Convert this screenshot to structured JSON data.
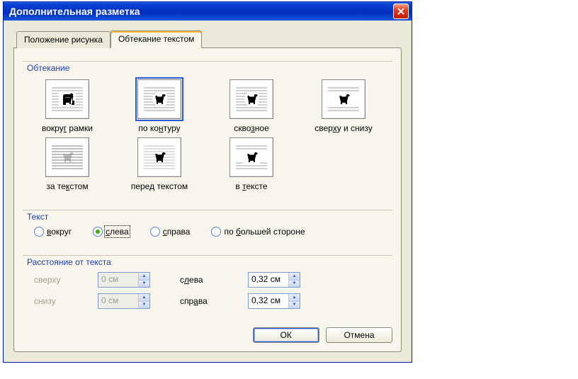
{
  "title": "Дополнительная разметка",
  "tabs": {
    "picture_pos": "Положение рисунка",
    "text_wrap": "Обтекание текстом"
  },
  "groups": {
    "wrap": "Обтекание",
    "textside": "Текст",
    "distance": "Расстояние от текста"
  },
  "wrap_options": {
    "around_frame": {
      "pre": "вокру",
      "accel": "г",
      "post": " рамки"
    },
    "contour": {
      "pre": "по ко",
      "accel": "н",
      "post": "туру"
    },
    "through": {
      "pre": "скво",
      "accel": "з",
      "post": "ное"
    },
    "top_bottom": {
      "pre": "свер",
      "accel": "х",
      "post": "у и снизу"
    },
    "behind": {
      "pre": "за те",
      "accel": "к",
      "post": "стом"
    },
    "in_front": {
      "pre": "пере",
      "accel": "д",
      "post": " текстом"
    },
    "inline": {
      "pre": "в ",
      "accel": "т",
      "post": "ексте"
    }
  },
  "textside": {
    "around": {
      "accel": "в",
      "post": "округ"
    },
    "left": {
      "accel": "с",
      "post": "лева"
    },
    "right": {
      "accel": "с",
      "post": "права"
    },
    "largest": {
      "pre": "по ",
      "accel": "б",
      "post": "ольшей стороне"
    }
  },
  "distance": {
    "top_label": "сверху",
    "top_value": "0 см",
    "bottom_label": "снизу",
    "bottom_value": "0 см",
    "left_pre": "с",
    "left_accel": "л",
    "left_post": "ева",
    "left_value": "0,32 см",
    "right_pre": "спр",
    "right_accel": "а",
    "right_post": "ва",
    "right_value": "0,32 см"
  },
  "buttons": {
    "ok": "ОК",
    "cancel": "Отмена"
  }
}
